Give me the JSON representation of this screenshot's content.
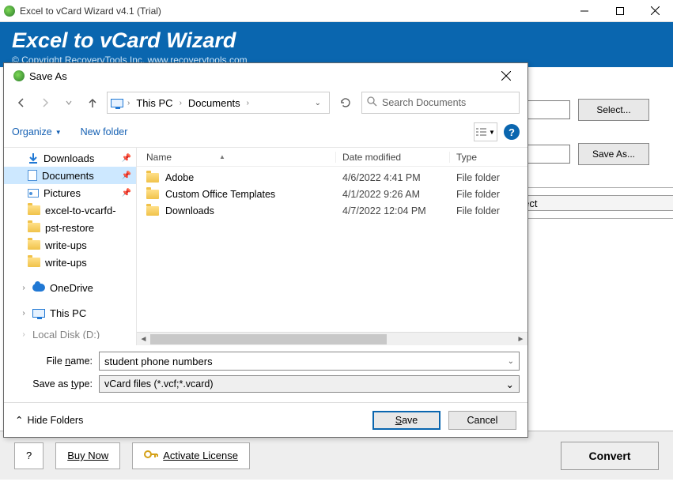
{
  "window": {
    "title": "Excel to vCard Wizard v4.1 (Trial)"
  },
  "banner": {
    "heading": "Excel to vCard Wizard",
    "copyright": "© Copyright RecoveryTools Inc. www.recoverytools.com"
  },
  "main": {
    "select_label": "Select...",
    "saveas_label": "Save As...",
    "field_text": "elect"
  },
  "bottom": {
    "help": "?",
    "buy": "Buy Now",
    "activate": "Activate License",
    "convert": "Convert"
  },
  "dialog": {
    "title": "Save As",
    "breadcrumb": {
      "p1": "This PC",
      "p2": "Documents"
    },
    "search_placeholder": "Search Documents",
    "organize": "Organize",
    "new_folder": "New folder",
    "columns": {
      "name": "Name",
      "date": "Date modified",
      "type": "Type"
    },
    "sidebar": [
      {
        "label": "Downloads",
        "icon": "download",
        "pinned": true,
        "indent": 2
      },
      {
        "label": "Documents",
        "icon": "document",
        "pinned": true,
        "indent": 2,
        "selected": true
      },
      {
        "label": "Pictures",
        "icon": "pictures",
        "pinned": true,
        "indent": 2
      },
      {
        "label": "excel-to-vcarfd-",
        "icon": "folder",
        "indent": 2
      },
      {
        "label": "pst-restore",
        "icon": "folder",
        "indent": 2
      },
      {
        "label": "write-ups",
        "icon": "folder",
        "indent": 2
      },
      {
        "label": "write-ups",
        "icon": "folder",
        "indent": 2
      }
    ],
    "top_level": [
      {
        "label": "OneDrive",
        "icon": "cloud",
        "expandable": true
      },
      {
        "label": "This PC",
        "icon": "pc",
        "expandable": true
      },
      {
        "label": "Local Disk (D:)",
        "icon": "drive",
        "expandable": true,
        "cut": true
      }
    ],
    "files": [
      {
        "name": "Adobe",
        "date": "4/6/2022 4:41 PM",
        "type": "File folder"
      },
      {
        "name": "Custom Office Templates",
        "date": "4/1/2022 9:26 AM",
        "type": "File folder"
      },
      {
        "name": "Downloads",
        "date": "4/7/2022 12:04 PM",
        "type": "File folder"
      }
    ],
    "file_name_label": "File name:",
    "file_name_value": "student phone numbers",
    "save_type_label": "Save as type:",
    "save_type_value": "vCard files (*.vcf;*.vcard)",
    "hide_folders": "Hide Folders",
    "save": "Save",
    "cancel": "Cancel"
  }
}
